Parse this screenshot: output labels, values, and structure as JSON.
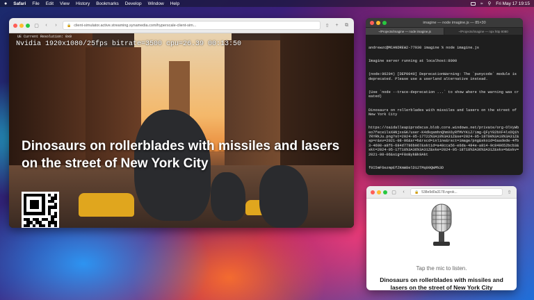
{
  "menubar": {
    "apple": "",
    "app": "Safari",
    "items": [
      "File",
      "Edit",
      "View",
      "History",
      "Bookmarks",
      "Develop",
      "Window",
      "Help"
    ],
    "clock": "Fri May 17  19:15"
  },
  "main_window": {
    "url": "client-simulator.active.streaming.synamedia.com/hyperscale-client-sim...",
    "stats_top": "UE Current Resolution: 0x0",
    "stats": "Nvidia 1920x1080/25fps bitrate=3500 cpu=26.39 00:13:50",
    "caption": "Dinosaurs on rollerblades with missiles and lasers on the street of New York City"
  },
  "terminal": {
    "title": "imagine — node imagine.js — 85×30",
    "tabs": [
      "~/Projects/imagine — node imagine.js",
      "~/Projects/imagine — npx http 8080"
    ],
    "lines": [
      "andrewzc@MCANDREW2-77930 imagine % node imagine.js",
      "Imagine server running at localhost:8000",
      "(node:96294) [DEP0040] DeprecationWarning: The `punycode` module is deprecated. Please use a userland alternative instead.",
      "(Use `node --trace-deprecation ...` to show where the warning was created)",
      "Dinosaurs on rollerblades with missiles and lasers on the street of New York City",
      "https://oaidalleapiprodscus.blob.core.windows.net/private/org-OlVyWbeo7fece1lsXHNjxsGK/user-K4dkqsmhnQhmX6yRfMVYKiZ/img-QFyY82bXF4lxDQ1h7RYRkJu.png?st=2024-05-17T22%3A19%3A31Z&se=2024-05-18T00%3A19%3A31Z&sp=r&sv=2021-08-06&sr=b&rscd=inline&rsct=image/png&skoid=6aadede-4fb3-4698-a8f6-684d7786b067&sktid=a48cca56-e6da-484e-a814-9c849652bcb3&skt=2024-05-17T18%3A36%3A31Z&ske=2024-05-18T18%3A36%3A31Z&sks=b&skv=2021-08-06&sig=F8oBykBk9Akt",
      "f9I5mF6ezmpEfZKmW8elD12TMq09QWM%3D"
    ]
  },
  "small_window": {
    "url": "538e9d0a3178.ngrok...",
    "tap_text": "Tap the mic to listen.",
    "caption": "Dinosaurs on rollerblades with missiles and lasers on the street of New York City"
  },
  "colors": {
    "accent_red": "#ff5f57",
    "accent_yellow": "#febc2e",
    "accent_green": "#28c840"
  },
  "icons": [
    "apple-icon",
    "back-icon",
    "forward-icon",
    "sidebar-icon",
    "lock-icon",
    "share-icon",
    "new-tab-icon",
    "tabs-icon",
    "microphone-icon",
    "qr-code"
  ]
}
